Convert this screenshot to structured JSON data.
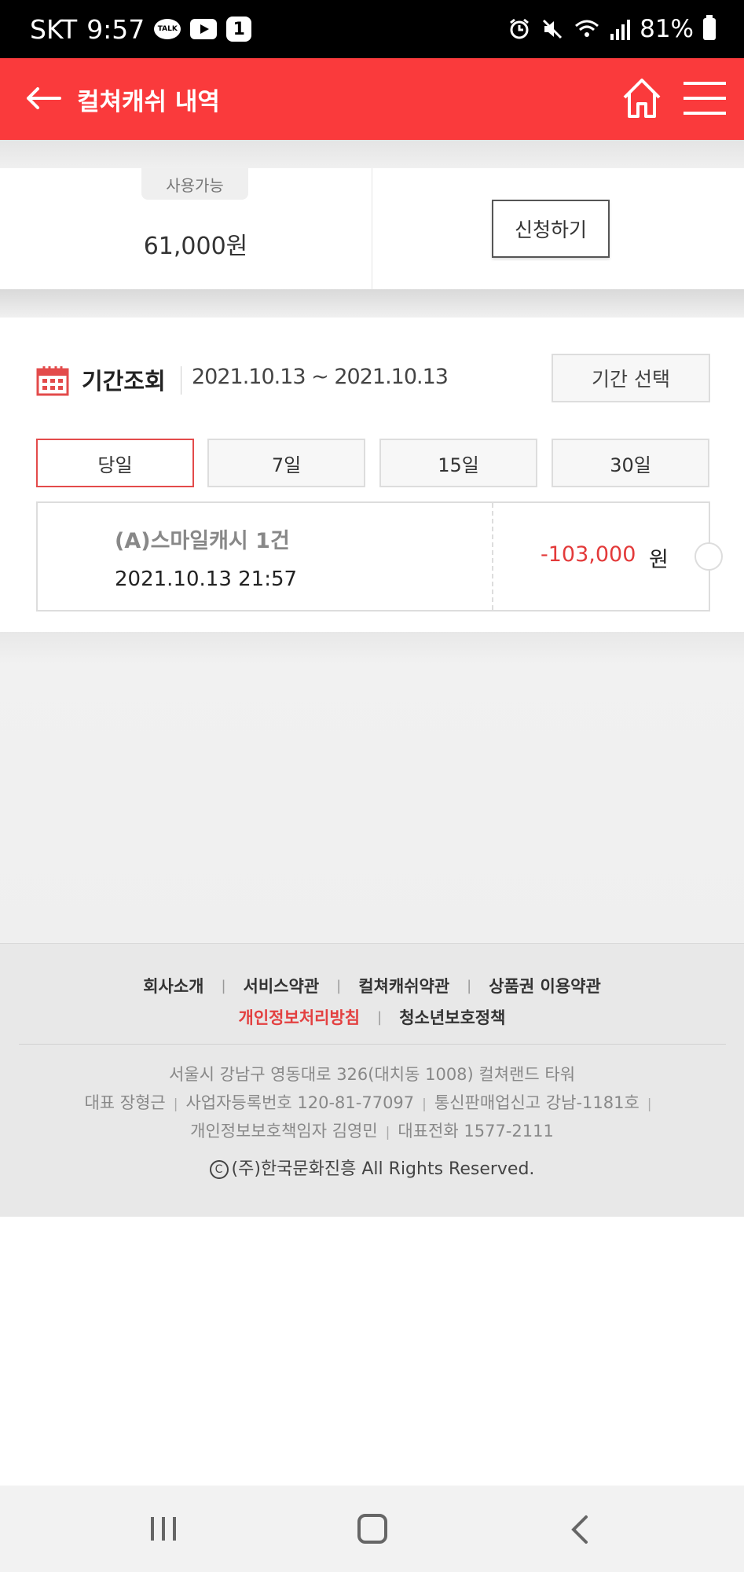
{
  "status_bar": {
    "carrier": "SKT",
    "time": "9:57",
    "talk_badge": "TALK",
    "notification_count": "1",
    "battery": "81%"
  },
  "header": {
    "title": "컬쳐캐쉬 내역",
    "accent_color": "#fa3a3c"
  },
  "balance": {
    "available_label": "사용가능",
    "amount": "61,000원",
    "apply_button": "신청하기"
  },
  "period": {
    "label": "기간조회",
    "range": "2021.10.13 ~ 2021.10.13",
    "select_button": "기간 선택",
    "tabs": [
      {
        "label": "당일",
        "active": true
      },
      {
        "label": "7일",
        "active": false
      },
      {
        "label": "15일",
        "active": false
      },
      {
        "label": "30일",
        "active": false
      }
    ]
  },
  "history": [
    {
      "title": "(A)스마일캐시 1건",
      "datetime": "2021.10.13 21:57",
      "amount": "-103,000",
      "unit": "원",
      "amount_color": "#e33a3a"
    }
  ],
  "footer": {
    "links_row1": [
      "회사소개",
      "서비스약관",
      "컬쳐캐쉬약관",
      "상품권 이용약관"
    ],
    "links_row2": [
      "개인정보처리방침",
      "청소년보호정책"
    ],
    "address": "서울시 강남구 영동대로 326(대치동 1008) 컬쳐랜드 타워",
    "ceo": "대표 장형근",
    "business_number": "사업자등록번호 120-81-77097",
    "ecommerce_registration": "통신판매업신고 강남-1181호",
    "privacy_officer": "개인정보보호책임자 김영민",
    "phone": "대표전화 1577-2111",
    "copyright": "(주)한국문화진흥 All Rights Reserved."
  }
}
